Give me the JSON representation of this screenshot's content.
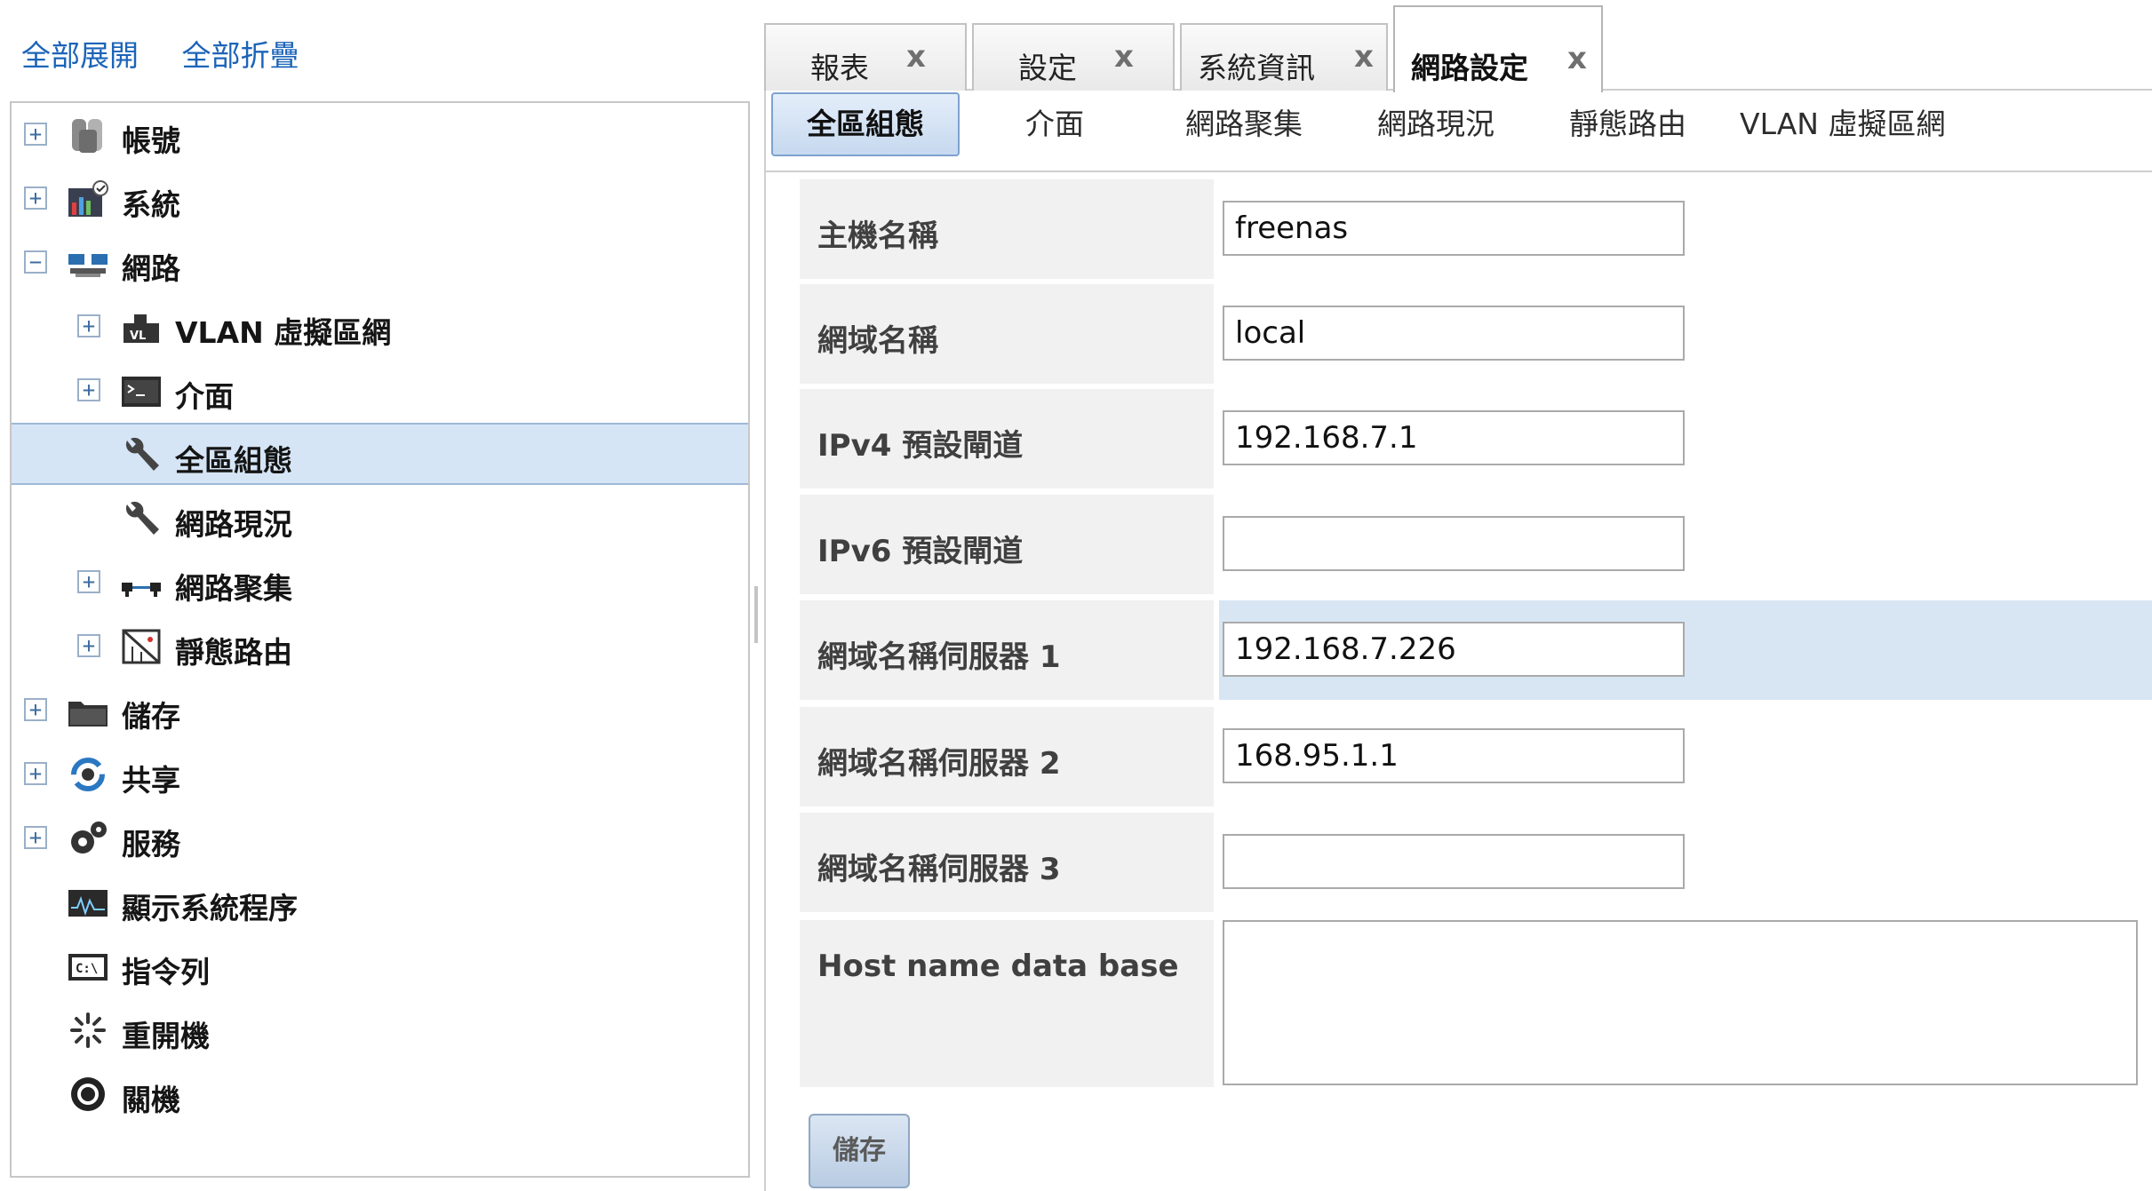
{
  "left": {
    "expand_all": "全部展開",
    "collapse_all": "全部折疊",
    "tree": [
      {
        "label": "帳號",
        "icon": "users-icon",
        "expander": "+"
      },
      {
        "label": "系統",
        "icon": "system-monitor-icon",
        "expander": "+"
      },
      {
        "label": "網路",
        "icon": "network-icon",
        "expander": "−"
      },
      {
        "label": "VLAN 虛擬區網",
        "icon": "vlan-icon",
        "expander": "+"
      },
      {
        "label": "介面",
        "icon": "terminal-icon",
        "expander": "+"
      },
      {
        "label": "全區組態",
        "icon": "wrench-icon",
        "selected": true
      },
      {
        "label": "網路現況",
        "icon": "wrench-icon"
      },
      {
        "label": "網路聚集",
        "icon": "link-aggregation-icon",
        "expander": "+"
      },
      {
        "label": "靜態路由",
        "icon": "static-route-icon",
        "expander": "+"
      },
      {
        "label": "儲存",
        "icon": "storage-folder-icon",
        "expander": "+"
      },
      {
        "label": "共享",
        "icon": "sharing-icon",
        "expander": "+"
      },
      {
        "label": "服務",
        "icon": "services-gear-icon",
        "expander": "+"
      },
      {
        "label": "顯示系統程序",
        "icon": "process-monitor-icon"
      },
      {
        "label": "指令列",
        "icon": "shell-icon"
      },
      {
        "label": "重開機",
        "icon": "reboot-icon"
      },
      {
        "label": "關機",
        "icon": "power-icon"
      }
    ]
  },
  "tabs": [
    {
      "label": "報表",
      "close": "x"
    },
    {
      "label": "設定",
      "close": "x"
    },
    {
      "label": "系統資訊",
      "close": "x"
    },
    {
      "label": "網路設定",
      "close": "x",
      "active": true
    }
  ],
  "subtabs": [
    "全區組態",
    "介面",
    "網路聚集",
    "網路現況",
    "靜態路由",
    "VLAN 虛擬區網"
  ],
  "form": {
    "hostname_label": "主機名稱",
    "hostname_value": "freenas",
    "domain_label": "網域名稱",
    "domain_value": "local",
    "ipv4_gw_label": "IPv4 預設閘道",
    "ipv4_gw_value": "192.168.7.1",
    "ipv6_gw_label": "IPv6 預設閘道",
    "ipv6_gw_value": "",
    "dns1_label": "網域名稱伺服器 1",
    "dns1_value": "192.168.7.226",
    "dns2_label": "網域名稱伺服器 2",
    "dns2_value": "168.95.1.1",
    "dns3_label": "網域名稱伺服器 3",
    "dns3_value": "",
    "hostdb_label": "Host name data base",
    "hostdb_value": "",
    "save_label": "儲存"
  },
  "colors": {
    "link": "#1c64b8",
    "selection": "#d5e5f6",
    "accent": "#7ea2cf"
  }
}
